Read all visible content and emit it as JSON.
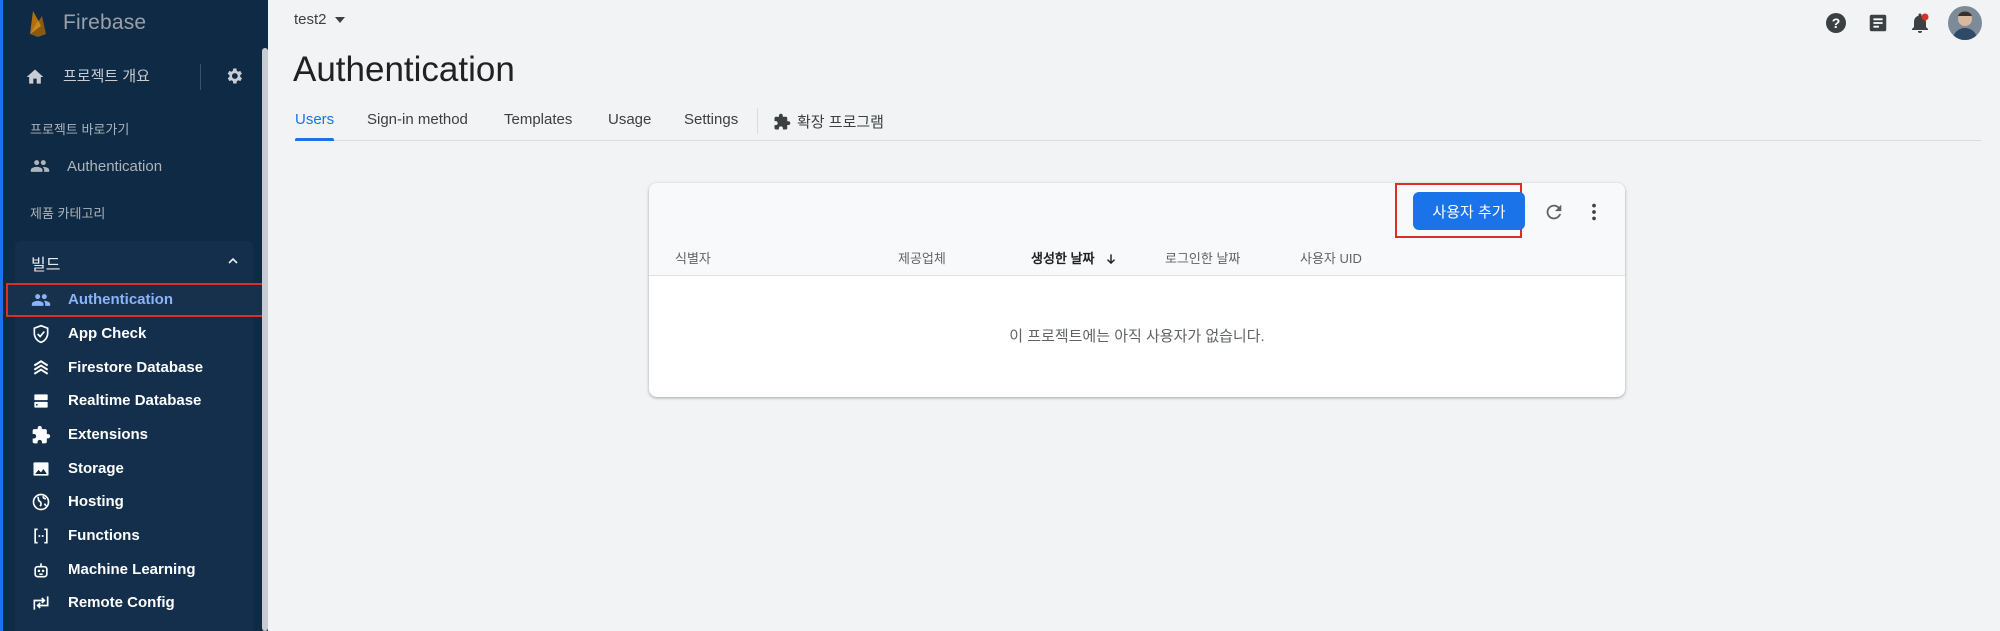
{
  "sidebar": {
    "brand": "Firebase",
    "overview_label": "프로젝트 개요",
    "shortcuts_title": "프로젝트 바로가기",
    "shortcut_items": [
      {
        "label": "Authentication",
        "icon": "people-icon"
      }
    ],
    "categories_title": "제품 카테고리",
    "build_label": "빌드",
    "nav_items": [
      {
        "label": "Authentication",
        "icon": "people-icon",
        "active": true
      },
      {
        "label": "App Check",
        "icon": "shield-check-icon"
      },
      {
        "label": "Firestore Database",
        "icon": "firestore-icon"
      },
      {
        "label": "Realtime Database",
        "icon": "database-icon"
      },
      {
        "label": "Extensions",
        "icon": "extensions-icon"
      },
      {
        "label": "Storage",
        "icon": "image-icon"
      },
      {
        "label": "Hosting",
        "icon": "globe-icon"
      },
      {
        "label": "Functions",
        "icon": "functions-icon"
      },
      {
        "label": "Machine Learning",
        "icon": "robot-icon"
      },
      {
        "label": "Remote Config",
        "icon": "remote-config-icon"
      }
    ]
  },
  "header": {
    "project": "test2",
    "title": "Authentication",
    "icons": [
      "help-icon",
      "feedback-icon",
      "notifications-icon",
      "avatar"
    ]
  },
  "tabs": [
    "Users",
    "Sign-in method",
    "Templates",
    "Usage",
    "Settings"
  ],
  "tab_extension": "확장 프로그램",
  "users_table": {
    "add_user": "사용자 추가",
    "columns": [
      "식별자",
      "제공업체",
      "생성한 날짜",
      "로그인한 날짜",
      "사용자 UID"
    ],
    "empty_message": "이 프로젝트에는 아직 사용자가 없습니다."
  },
  "colors": {
    "accent": "#1a73e8",
    "sidebar_bg": "#0f2a45",
    "highlight": "#d93025"
  }
}
